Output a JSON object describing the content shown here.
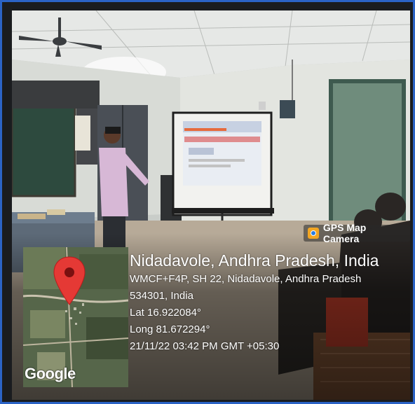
{
  "overlay": {
    "app_label": "GPS Map Camera",
    "icons": {
      "app": "gps-map-camera-icon",
      "pin": "map-pin-icon"
    },
    "colors": {
      "frame": "#2b63c6",
      "pin": "#e53935",
      "badge": "#f3a623"
    }
  },
  "location": {
    "place": "Nidadavole, Andhra Pradesh, India",
    "address_line1": "WMCF+F4P, SH 22, Nidadavole, Andhra Pradesh",
    "address_line2": "534301, India",
    "latitude": "Lat 16.922084°",
    "longitude": "Long 81.672294°",
    "timestamp": "21/11/22 03:42 PM GMT +05:30"
  },
  "map": {
    "provider_mark": "Google"
  }
}
